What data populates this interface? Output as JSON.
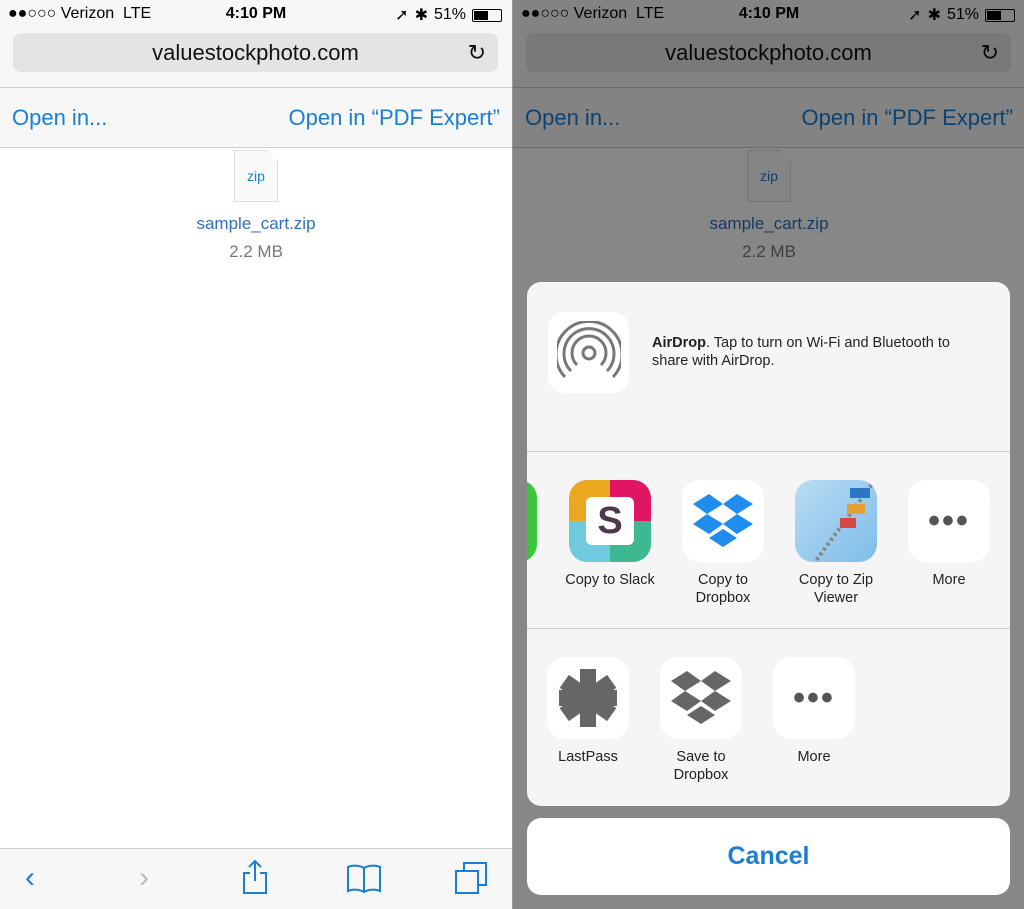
{
  "status": {
    "carrier": "●●○○○ Verizon",
    "network": "LTE",
    "time": "4:10 PM",
    "battery": "51%"
  },
  "browser": {
    "url": "valuestockphoto.com",
    "open_in": "Open in...",
    "open_in_app": "Open in “PDF Expert”"
  },
  "file": {
    "type_label": "zip",
    "name": "sample_cart.zip",
    "size": "2.2 MB"
  },
  "share_sheet": {
    "airdrop_title": "AirDrop",
    "airdrop_text": ". Tap to turn on Wi-Fi and Bluetooth to share with AirDrop.",
    "apps": [
      {
        "label": "Copy to Slack"
      },
      {
        "label": "Copy to Dropbox"
      },
      {
        "label": "Copy to Zip Viewer"
      },
      {
        "label": "More"
      }
    ],
    "actions": [
      {
        "label": "LastPass"
      },
      {
        "label": "Save to Dropbox"
      },
      {
        "label": "More"
      }
    ],
    "cancel": "Cancel"
  },
  "colors": {
    "accent": "#1a7fd4"
  }
}
